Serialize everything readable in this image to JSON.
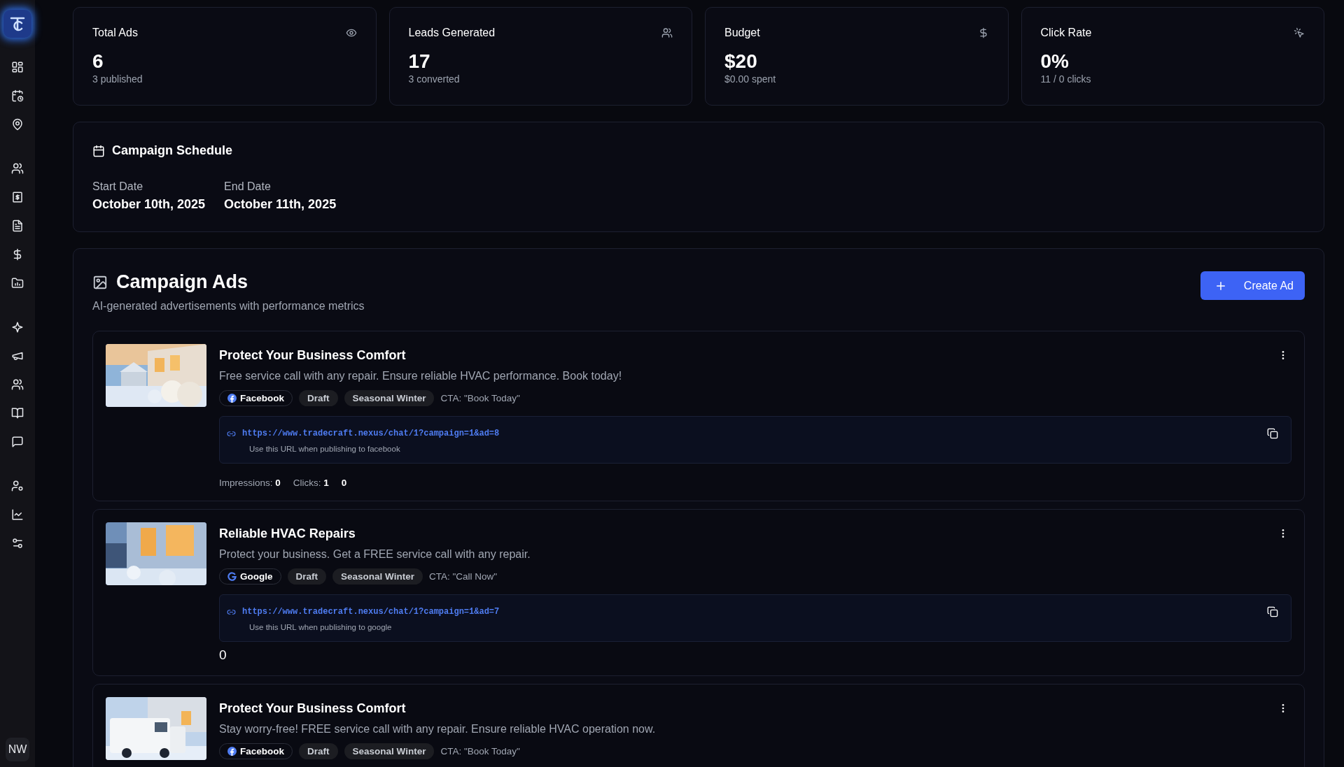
{
  "sidebar": {
    "avatar": "NW"
  },
  "stats": [
    {
      "kind": "eye",
      "title": "Total Ads",
      "value": "6",
      "sub": "3 published"
    },
    {
      "kind": "users",
      "title": "Leads Generated",
      "value": "17",
      "sub": "3 converted"
    },
    {
      "kind": "dollar",
      "title": "Budget",
      "value": "$20",
      "sub": "$0.00 spent"
    },
    {
      "kind": "click",
      "title": "Click Rate",
      "value": "0%",
      "sub": "11 / 0 clicks"
    }
  ],
  "schedule": {
    "title": "Campaign Schedule",
    "fields": [
      {
        "label": "Start Date",
        "value": "October 10th, 2025"
      },
      {
        "label": "End Date",
        "value": "October 11th, 2025"
      }
    ]
  },
  "ads_panel": {
    "title": "Campaign Ads",
    "subtitle": "AI-generated advertisements with performance metrics",
    "create_button": "Create Ad",
    "ads": [
      {
        "title": "Protect Your Business Comfort",
        "description": "Free service call with any repair. Ensure reliable HVAC performance. Book today!",
        "platform": {
          "kind": "facebook",
          "label": "Facebook"
        },
        "status": "Draft",
        "tag": "Seasonal Winter",
        "cta": "CTA: \"Book Today\"",
        "url": "https://www.tradecraft.nexus/chat/1?campaign=1&ad=8",
        "url_hint": "Use this URL when publishing to facebook",
        "metrics": [
          {
            "label": "Impressions:",
            "value": "0"
          },
          {
            "label": "Clicks:",
            "value": "1"
          }
        ],
        "extra": {
          "kind": "inline",
          "text": "0"
        }
      },
      {
        "title": "Reliable HVAC Repairs",
        "description": "Protect your business. Get a FREE service call with any repair.",
        "platform": {
          "kind": "google",
          "label": "Google"
        },
        "status": "Draft",
        "tag": "Seasonal Winter",
        "cta": "CTA: \"Call Now\"",
        "url": "https://www.tradecraft.nexus/chat/1?campaign=1&ad=7",
        "url_hint": "Use this URL when publishing to google",
        "extra": {
          "kind": "standalone",
          "text": "0"
        }
      },
      {
        "title": "Protect Your Business Comfort",
        "description": "Stay worry-free! FREE service call with any repair. Ensure reliable HVAC operation now.",
        "platform": {
          "kind": "facebook",
          "label": "Facebook"
        },
        "status": "Draft",
        "tag": "Seasonal Winter",
        "cta": "CTA: \"Book Today\""
      }
    ]
  }
}
